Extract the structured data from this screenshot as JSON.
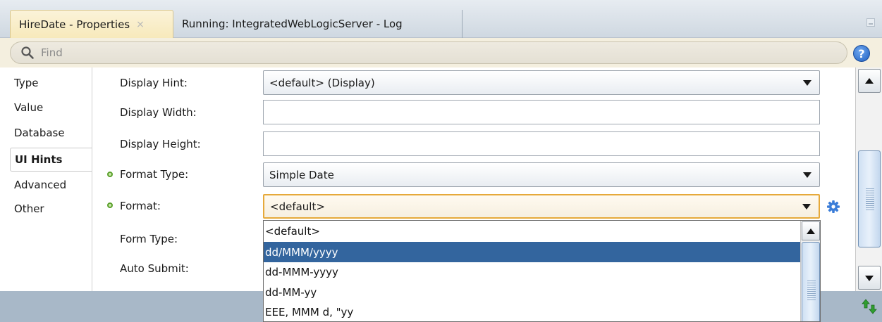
{
  "tabs": [
    {
      "label": "HireDate - Properties",
      "close": "×",
      "active": true
    },
    {
      "label": "Running: IntegratedWebLogicServer - Log",
      "active": false
    }
  ],
  "find": {
    "placeholder": "Find",
    "icon": "search-icon"
  },
  "help": {
    "glyph": "?",
    "icon": "help-icon"
  },
  "categories": [
    "Type",
    "Value",
    "Database",
    "UI Hints",
    "Advanced",
    "Other"
  ],
  "selected_category": "UI Hints",
  "properties": {
    "display_hint": {
      "label": "Display Hint:",
      "value": "<default> (Display)"
    },
    "display_width": {
      "label": "Display Width:",
      "value": ""
    },
    "display_height": {
      "label": "Display Height:",
      "value": ""
    },
    "format_type": {
      "label": "Format Type:",
      "value": "Simple Date"
    },
    "format": {
      "label": "Format:",
      "value": "<default>"
    },
    "form_type": {
      "label": "Form Type:"
    },
    "auto_submit": {
      "label": "Auto Submit:"
    }
  },
  "format_options": [
    "<default>",
    "dd/MMM/yyyy",
    "dd-MMM-yyyy",
    "dd-MM-yy",
    "EEE, MMM d, \"yy"
  ],
  "format_highlighted": "dd/MMM/yyyy",
  "colors": {
    "selection": "#33659e",
    "focus_border": "#e6a93a",
    "active_tab": "#f7e9bb",
    "status_bar": "#a8b8c8"
  }
}
